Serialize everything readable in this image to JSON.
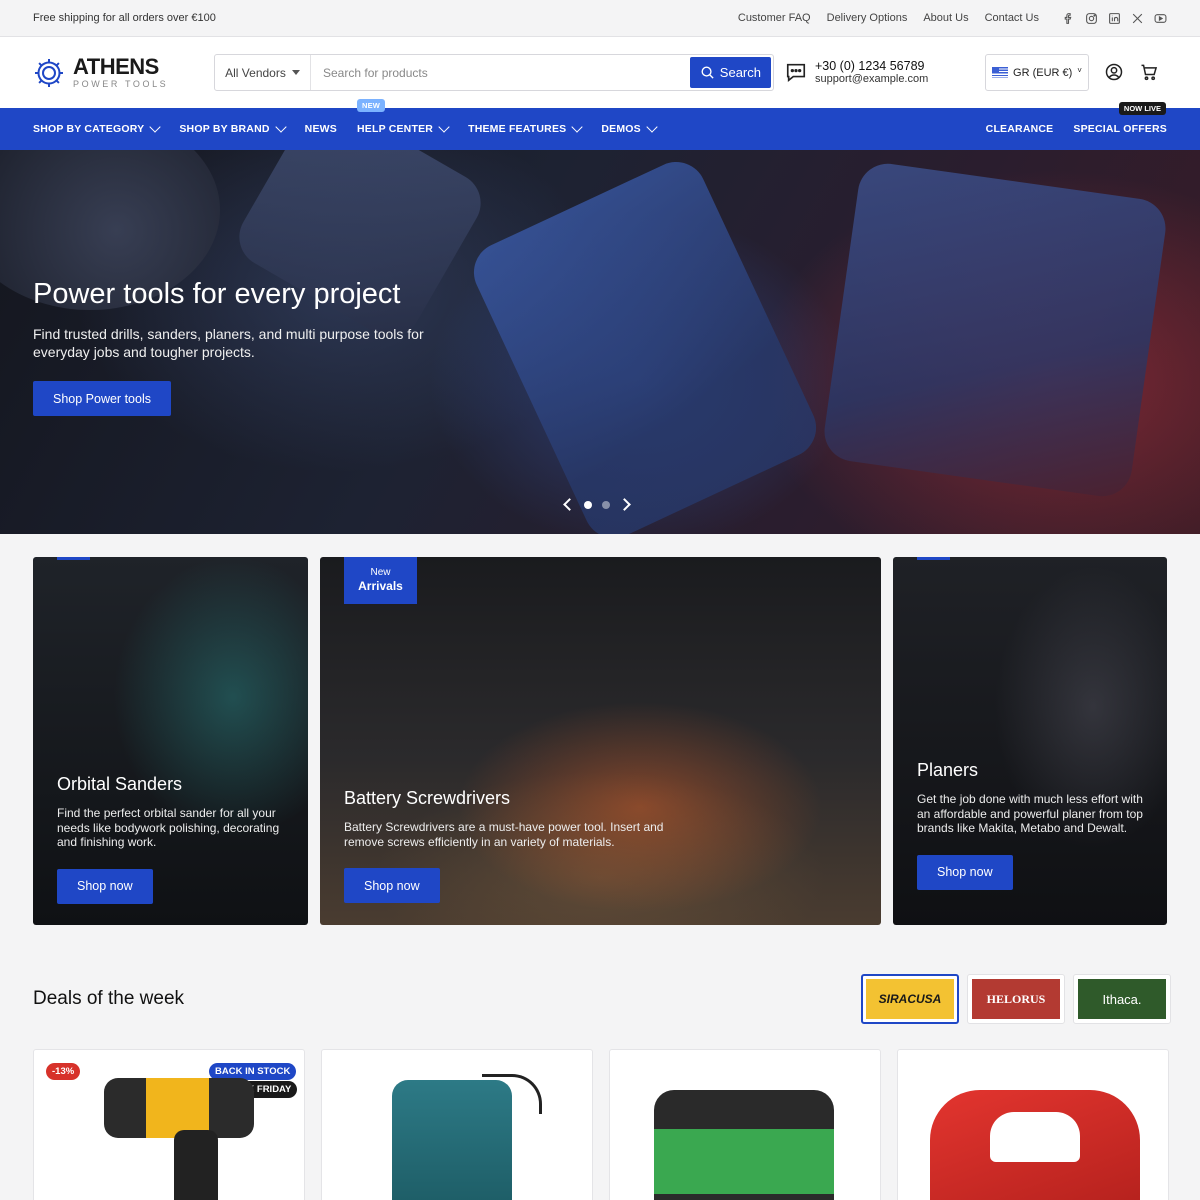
{
  "topbar": {
    "announcement": "Free shipping for all orders over €100",
    "links": [
      "Customer FAQ",
      "Delivery Options",
      "About Us",
      "Contact Us"
    ],
    "socials": [
      "facebook-icon",
      "instagram-icon",
      "linkedin-icon",
      "x-icon",
      "youtube-icon"
    ]
  },
  "header": {
    "logo_name": "ATHENS",
    "logo_sub": "POWER TOOLS",
    "vendor_select": "All Vendors",
    "search_placeholder": "Search for products",
    "search_button": "Search",
    "phone": "+30 (0) 1234 56789",
    "email": "support@example.com",
    "currency": "GR (EUR €)"
  },
  "nav": {
    "left": [
      {
        "label": "SHOP BY CATEGORY",
        "has_menu": true
      },
      {
        "label": "SHOP BY BRAND",
        "has_menu": true
      },
      {
        "label": "NEWS",
        "has_menu": false
      },
      {
        "label": "HELP CENTER",
        "has_menu": true,
        "badge": "NEW"
      },
      {
        "label": "THEME FEATURES",
        "has_menu": true
      },
      {
        "label": "DEMOS",
        "has_menu": true
      }
    ],
    "right": [
      {
        "label": "CLEARANCE"
      },
      {
        "label": "SPECIAL OFFERS",
        "badge": "NOW LIVE"
      }
    ]
  },
  "hero": {
    "title": "Power tools for every project",
    "description": "Find trusted drills, sanders, planers, and multi purpose tools for everyday jobs and tougher projects.",
    "button": "Shop Power tools",
    "slide_count": 2,
    "active_slide": 1
  },
  "collections": [
    {
      "title": "Orbital Sanders",
      "description": "Find the perfect orbital sander for all your needs like bodywork polishing, decorating and finishing work.",
      "button": "Shop now"
    },
    {
      "title": "Battery Screwdrivers",
      "description": "Battery Screwdrivers are a must-have power tool. Insert and remove screws efficiently in an variety of materials.",
      "button": "Shop now",
      "badge_small": "New",
      "badge_big": "Arrivals"
    },
    {
      "title": "Planers",
      "description": "Get the job done with much less effort with an affordable and powerful planer from top brands like Makita, Metabo and Dewalt.",
      "button": "Shop now"
    }
  ],
  "deals": {
    "title": "Deals of the week",
    "brands": [
      {
        "name": "SIRACUSA",
        "bg": "#f3c232",
        "fg": "#1a1a1a"
      },
      {
        "name": "HELORUS",
        "bg": "#b33a32",
        "fg": "#ffffff"
      },
      {
        "name": "Ithaca.",
        "bg": "#2f5a2a",
        "fg": "#ffffff"
      }
    ],
    "products": [
      {
        "discount": "-13%",
        "badges": [
          "BACK IN STOCK",
          "BLACK FRIDAY"
        ]
      },
      {},
      {},
      {}
    ]
  },
  "colors": {
    "accent": "#1f47c6",
    "sale": "#d7322a"
  }
}
